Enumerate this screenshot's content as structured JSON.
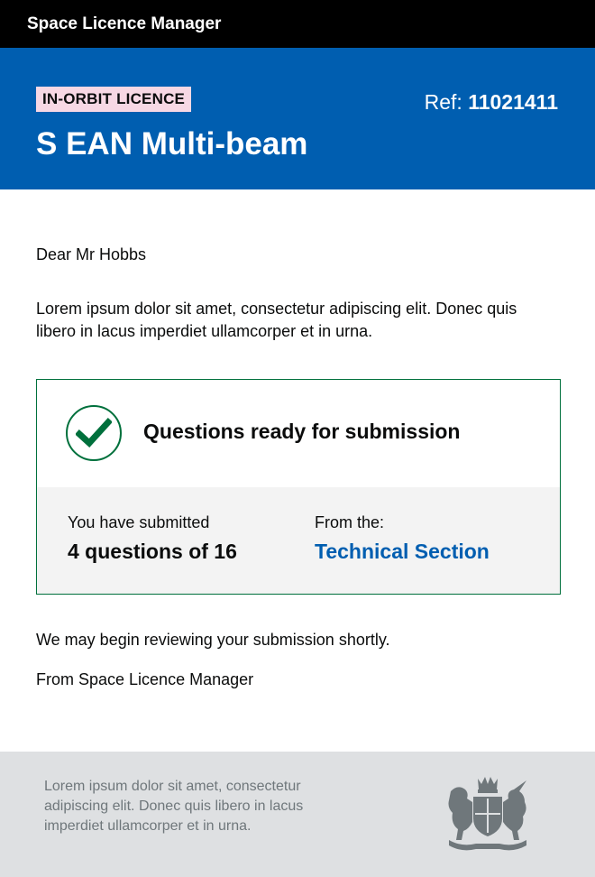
{
  "header": {
    "app_name": "Space Licence Manager"
  },
  "banner": {
    "tag": "IN-ORBIT LICENCE",
    "ref_label": "Ref: ",
    "ref_number": "11021411",
    "title": "S EAN Multi-beam",
    "accent_color": "#005eb0",
    "tag_color": "#f7d8e4"
  },
  "letter": {
    "greeting": "Dear Mr Hobbs",
    "intro": "Lorem ipsum dolor sit amet, consectetur adipiscing elit. Donec quis libero in lacus imperdiet ullamcorper et in urna.",
    "review": "We may begin reviewing your submission shortly.",
    "signoff": "From Space Licence Manager"
  },
  "panel": {
    "icon": "check-circle-icon",
    "status_color": "#00703c",
    "heading": "Questions ready for submission",
    "submitted_label": "You have submitted",
    "submitted_value": "4 questions of 16",
    "from_label": "From the:",
    "from_value": "Technical Section"
  },
  "footer": {
    "text": "Lorem ipsum dolor sit amet, consectetur adipiscing elit. Donec quis libero in lacus imperdiet ullamcorper et in urna.",
    "logo": "royal-coat-of-arms-icon"
  }
}
